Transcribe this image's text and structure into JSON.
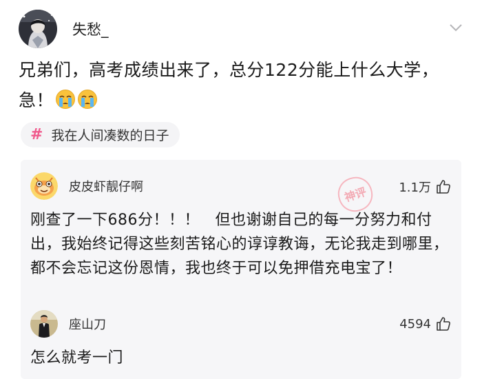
{
  "post": {
    "author": "失愁_",
    "text": "兄弟们，高考成绩出来了，总分122分能上什么大学，急！",
    "emojis": [
      "crying-face",
      "crying-face"
    ],
    "topic_symbol": "#",
    "topic": "我在人间凑数的日子"
  },
  "comments": [
    {
      "author": "皮皮虾靓仔啊",
      "likes": "1.1万",
      "text": "刚查了一下686分！！！　但也谢谢自己的每一分努力和付出，我始终记得这些刻苦铭心的谆谆教诲，无论我走到哪里，都不会忘记这份恩情，我也终于可以免押借充电宝了！",
      "badge": "神评",
      "avatar_icon": "cartoon-shrimp-avatar"
    },
    {
      "author": "座山刀",
      "likes": "4594",
      "text": "怎么就考一门",
      "avatar_icon": "person-photo-avatar"
    }
  ],
  "colors": {
    "accent_pink": "#f05a8c",
    "badge_red": "#f26d7d",
    "comment_bg": "#f6f6f8"
  }
}
